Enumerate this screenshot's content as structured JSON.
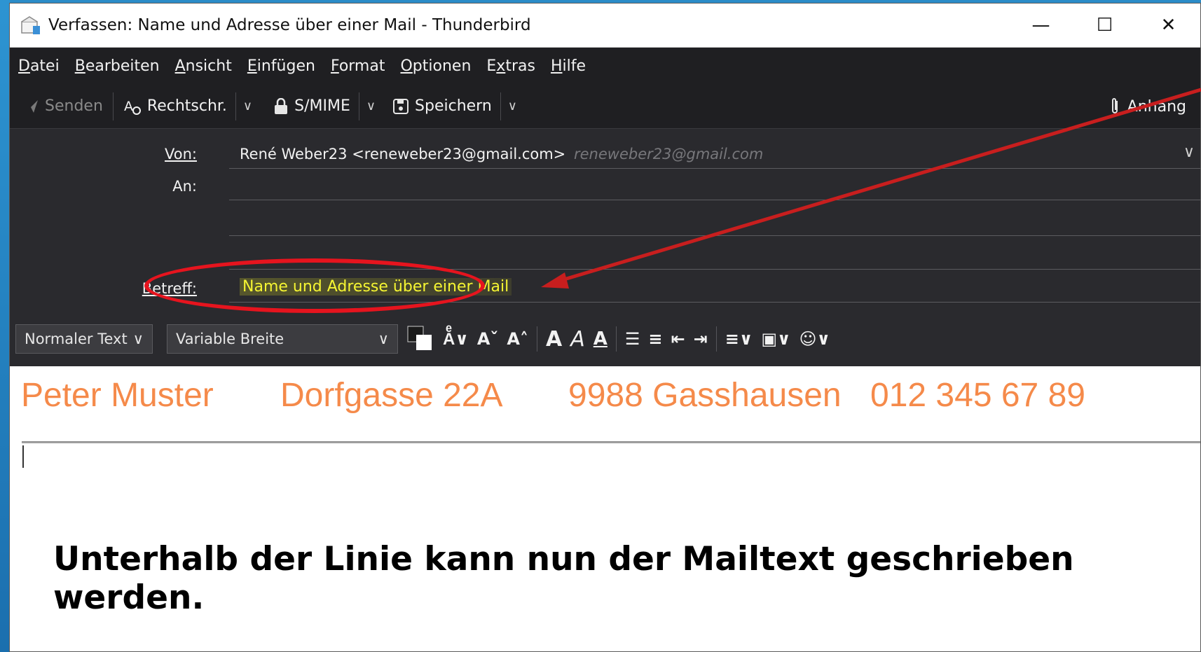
{
  "window": {
    "title": "Verfassen: Name und Adresse über einer Mail - Thunderbird",
    "minimize": "—",
    "maximize": "☐",
    "close": "✕"
  },
  "menu": [
    {
      "label": "Datei",
      "underline": "D",
      "rest": "atei"
    },
    {
      "label": "Bearbeiten",
      "underline": "B",
      "rest": "earbeiten"
    },
    {
      "label": "Ansicht",
      "underline": "A",
      "rest": "nsicht"
    },
    {
      "label": "Einfügen",
      "underline": "E",
      "rest": "infügen"
    },
    {
      "label": "Format",
      "underline": "F",
      "rest": "ormat"
    },
    {
      "label": "Optionen",
      "underline": "O",
      "rest": "ptionen"
    },
    {
      "label": "Extras",
      "pre": "E",
      "underline": "x",
      "rest": "tras"
    },
    {
      "label": "Hilfe",
      "underline": "H",
      "rest": "ilfe"
    }
  ],
  "toolbar": {
    "send": "Senden",
    "spell": "Rechtschr.",
    "smime": "S/MIME",
    "save": "Speichern",
    "attach": "Anhang"
  },
  "header": {
    "from_label": "Von:",
    "from_value": "René Weber23 <reneweber23@gmail.com>",
    "from_hint": "reneweber23@gmail.com",
    "to_label": "An:",
    "subject_label": "Betreff:",
    "subject_value": "Name und Adresse über einer Mail"
  },
  "format": {
    "paragraph": "Normaler Text",
    "font": "Variable Breite"
  },
  "signature": {
    "name": "Peter Muster",
    "street": "Dorfgasse 22A",
    "city": "9988 Gasshausen",
    "phone": "012 345 67 89"
  },
  "annotation": "Unterhalb der Linie kann nun der Mailtext geschrieben werden.",
  "colors": {
    "highlight": "#e6141e",
    "signature": "#f58a4a",
    "subject": "#f5f532"
  }
}
